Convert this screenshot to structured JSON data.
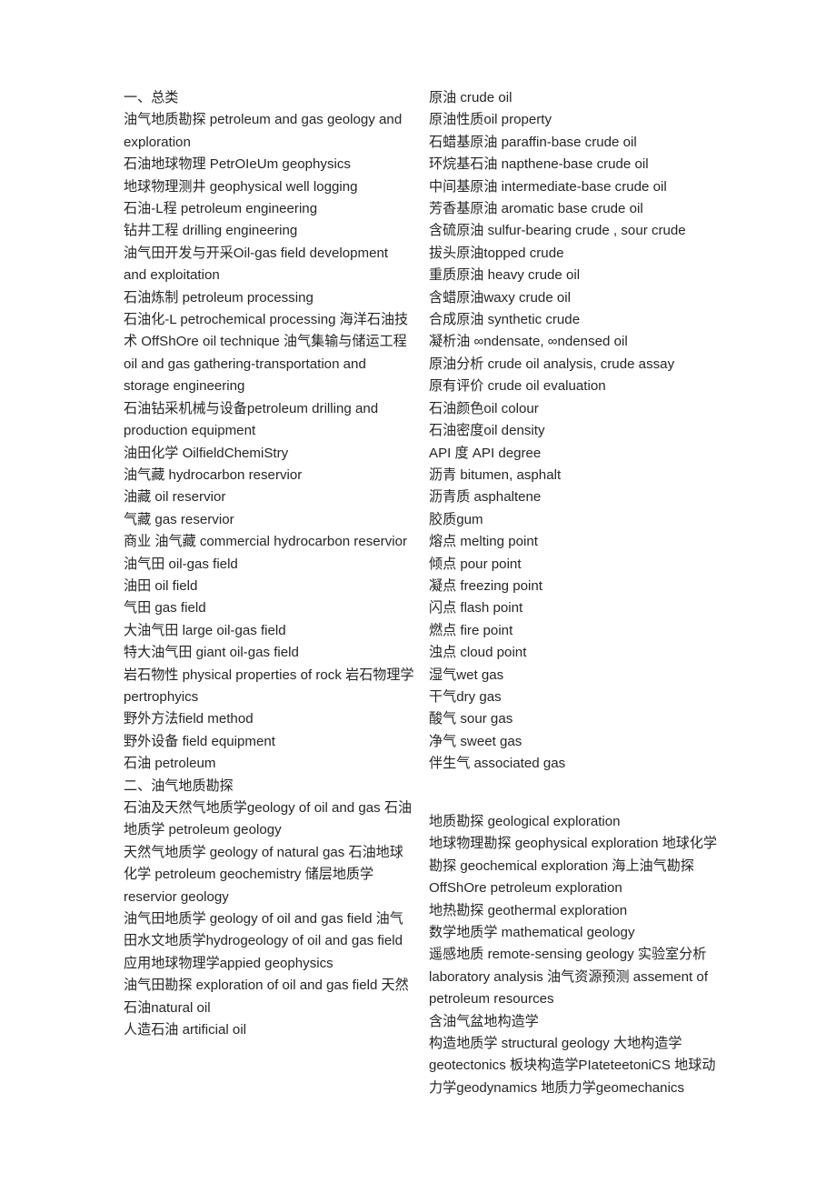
{
  "document": {
    "background_color": "#ffffff",
    "text_color": "#262626"
  },
  "left_column": {
    "section_one": {
      "heading": "一、总类",
      "entries": [
        "油气地质勘探 petroleum and gas geology and exploration",
        "石油地球物理 PetrOIeUm geophysics",
        "地球物理测井 geophysical well logging",
        "石油-L程 petroleum engineering",
        "钻井工程 drilling engineering",
        "油气田开发与开采Oil-gas field development and exploitation",
        "石油炼制 petroleum processing",
        "石油化-L petrochemical processing 海洋石油技术 OffShOre oil technique 油气集输与储运工程oil and gas gathering-transportation and storage engineering",
        "石油钻采机械与设备petroleum drilling and production equipment",
        "油田化学 OilfieldChemiStry",
        "油气藏 hydrocarbon reservior",
        "油藏 oil reservior",
        "气藏 gas reservior",
        "商业 油气藏 commercial hydrocarbon reservior",
        "油气田 oil-gas field",
        "油田 oil field",
        "气田 gas field",
        "大油气田 large oil-gas field",
        "特大油气田 giant oil-gas field",
        "岩石物性 physical properties of rock 岩石物理学pertrophyics",
        "野外方法field method",
        "野外设备 field equipment",
        "石油 petroleum"
      ]
    },
    "section_two": {
      "heading": "二、油气地质勘探",
      "entries": [
        "石油及天然气地质学geology of oil and gas 石油地质学 petroleum geology",
        "天然气地质学 geology of natural gas 石油地球化学 petroleum geochemistry 储层地质学 reservior geology",
        "油气田地质学 geology of oil and gas field 油气田水文地质学hydrogeology of oil and gas field",
        "应用地球物理学appied geophysics",
        "油气田勘探 exploration of oil and gas field 天然石油natural oil",
        "人造石油 artificial oil"
      ]
    }
  },
  "right_column": {
    "block_one": {
      "entries": [
        "原油 crude oil",
        "原油性质oil property",
        "石蜡基原油 paraffin-base crude oil",
        "环烷基石油 napthene-base crude oil",
        "中间基原油 intermediate-base crude oil",
        "芳香基原油 aromatic base crude oil",
        "含硫原油 sulfur-bearing crude , sour crude",
        "拔头原油topped crude",
        "重质原油 heavy crude oil",
        "含蜡原油waxy crude oil",
        "合成原油 synthetic crude",
        "凝析油 ∞ndensate, ∞ndensed oil",
        "原油分析 crude oil analysis, crude assay",
        "原有评价 crude oil evaluation",
        "石油颜色oil colour",
        "石油密度oil density",
        "API 度 API degree",
        "沥青 bitumen, asphalt",
        "沥青质 asphaltene",
        "胶质gum",
        "熔点 melting point",
        "倾点 pour point",
        "凝点 freezing point",
        "闪点 flash point",
        "燃点 fire point",
        "浊点 cloud point",
        "湿气wet gas",
        "干气dry gas",
        "酸气 sour gas",
        "净气 sweet gas",
        "伴生气 associated gas"
      ]
    },
    "block_two": {
      "entries": [
        "地质勘探 geological exploration",
        "地球物理勘探 geophysical exploration 地球化学勘探 geochemical exploration 海上油气勘探 OffShOre petroleum exploration",
        "地热勘探 geothermal exploration",
        "数学地质学 mathematical geology",
        "遥感地质 remote-sensing geology 实验室分析 laboratory analysis 油气资源预测 assement of petroleum resources",
        "含油气盆地构造学",
        "构造地质学 structural geology 大地构造学 geotectonics 板块构造学PIateteetoniCS 地球动力学geodynamics 地质力学geomechanics"
      ]
    }
  }
}
